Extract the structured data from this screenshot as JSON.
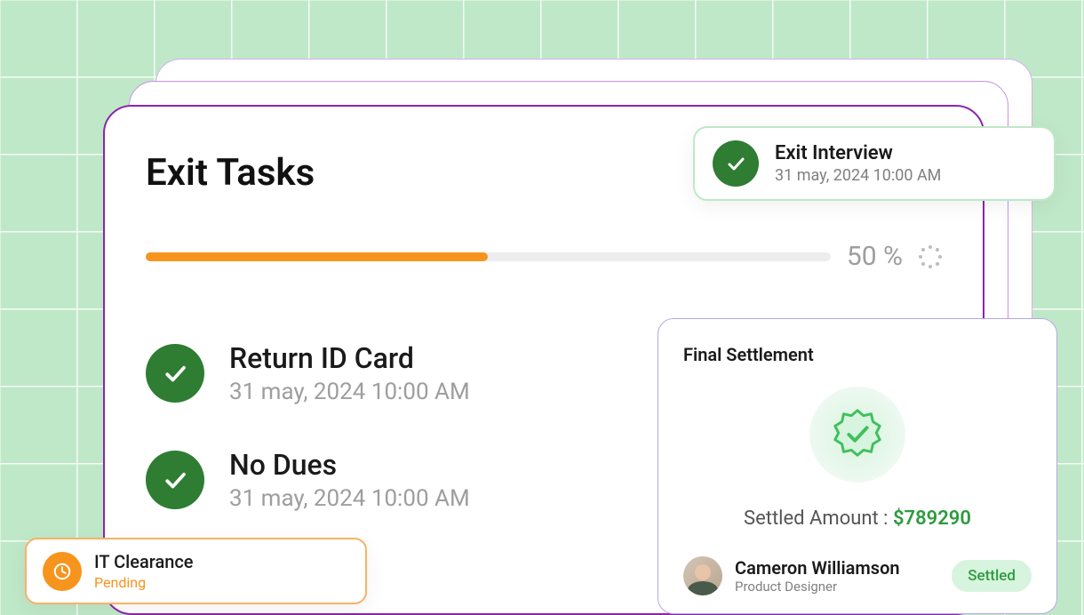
{
  "main": {
    "title": "Exit Tasks",
    "progress_percent": "50 %",
    "tasks": [
      {
        "title": "Return ID Card",
        "date": "31 may, 2024 10:00 AM"
      },
      {
        "title": "No Dues",
        "date": "31 may, 2024 10:00 AM"
      }
    ]
  },
  "interview_card": {
    "title": "Exit Interview",
    "date": "31 may, 2024 10:00 AM"
  },
  "clearance_card": {
    "title": "IT Clearance",
    "status": "Pending"
  },
  "settlement": {
    "title": "Final Settlement",
    "amount_label": "Settled Amount : ",
    "amount_value": "$789290",
    "person_name": "Cameron Williamson",
    "person_role": "Product Designer",
    "status": "Settled"
  }
}
